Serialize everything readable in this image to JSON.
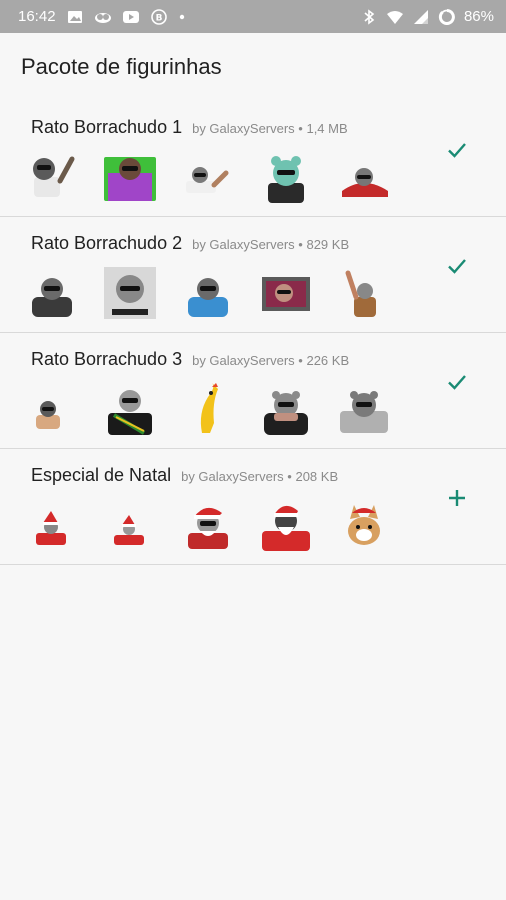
{
  "status_bar": {
    "time": "16:42",
    "battery_percent": "86%",
    "left_icons": [
      "image-icon",
      "cloud-icon",
      "youtube-icon",
      "bitcoin-icon",
      "dot-icon"
    ],
    "right_icons": [
      "bluetooth-icon",
      "wifi-icon",
      "signal-icon",
      "battery-icon"
    ]
  },
  "app_bar": {
    "title": "Pacote de figurinhas"
  },
  "packs": [
    {
      "name": "Rato Borrachudo 1",
      "author": "by GalaxyServers",
      "size": "1,4 MB",
      "action": "installed",
      "action_icon": "check-icon",
      "stickers": [
        "sticker-rat-waving",
        "sticker-person-green-bg",
        "sticker-rat-lying",
        "sticker-rat-sunglasses-person",
        "sticker-rat-red-car"
      ]
    },
    {
      "name": "Rato Borrachudo 2",
      "author": "by GalaxyServers",
      "size": "829 KB",
      "action": "installed",
      "action_icon": "check-icon",
      "stickers": [
        "sticker-rat-dark-shirt",
        "sticker-rat-poster",
        "sticker-rat-blue-shirt",
        "sticker-rat-gym",
        "sticker-rat-arms-up"
      ]
    },
    {
      "name": "Rato Borrachudo 3",
      "author": "by GalaxyServers",
      "size": "226 KB",
      "action": "installed",
      "action_icon": "check-icon",
      "stickers": [
        "sticker-rat-small",
        "sticker-rat-suit-sash",
        "sticker-rubber-chicken",
        "sticker-rat-thinking",
        "sticker-rat-gray"
      ]
    },
    {
      "name": "Especial de Natal",
      "author": "by GalaxyServers",
      "size": "208 KB",
      "action": "add",
      "action_icon": "plus-icon",
      "stickers": [
        "sticker-santa-rat-small",
        "sticker-santa-rat-2",
        "sticker-santa-rat-sunglasses",
        "sticker-santa-rat-dark",
        "sticker-corgi-santa"
      ]
    }
  ],
  "colors": {
    "accent": "#1a8b74",
    "status_bar": "#a8a8a8",
    "background": "#f7f7f7",
    "divider": "#d9d9d9",
    "meta_text": "#8a8a8a"
  }
}
